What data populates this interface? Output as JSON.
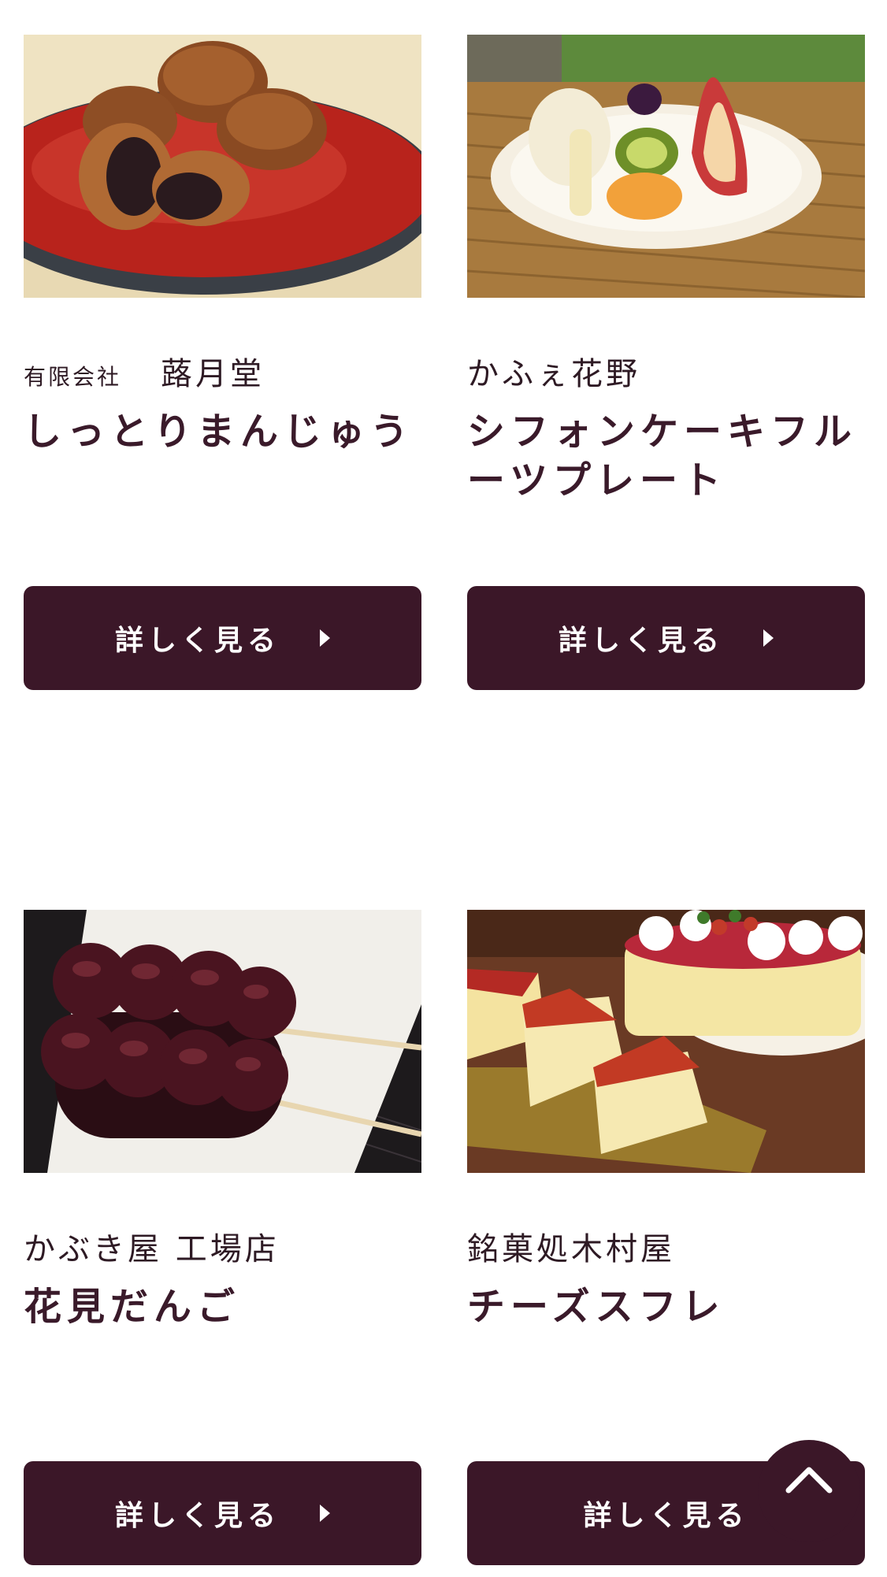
{
  "cards": [
    {
      "corp": "有限会社",
      "shop": "蕗月堂",
      "product": "しっとりまんじゅう",
      "button_label": "詳しく見る",
      "photo_icon": "manju-photo"
    },
    {
      "corp": "",
      "shop": "かふぇ花野",
      "product": "シフォンケーキフルーツプレート",
      "button_label": "詳しく見る",
      "photo_icon": "fruit-plate-photo"
    },
    {
      "corp": "",
      "shop": "かぶき屋 工場店",
      "product": "花見だんご",
      "button_label": "詳しく見る",
      "photo_icon": "dango-photo"
    },
    {
      "corp": "",
      "shop": "銘菓処木村屋",
      "product": "チーズスフレ",
      "button_label": "詳しく見る",
      "photo_icon": "cheese-souffle-photo"
    }
  ],
  "colors": {
    "button_bg": "#3b1728",
    "title_text": "#3a1a2a"
  },
  "back_to_top_icon": "chevron-up-icon"
}
